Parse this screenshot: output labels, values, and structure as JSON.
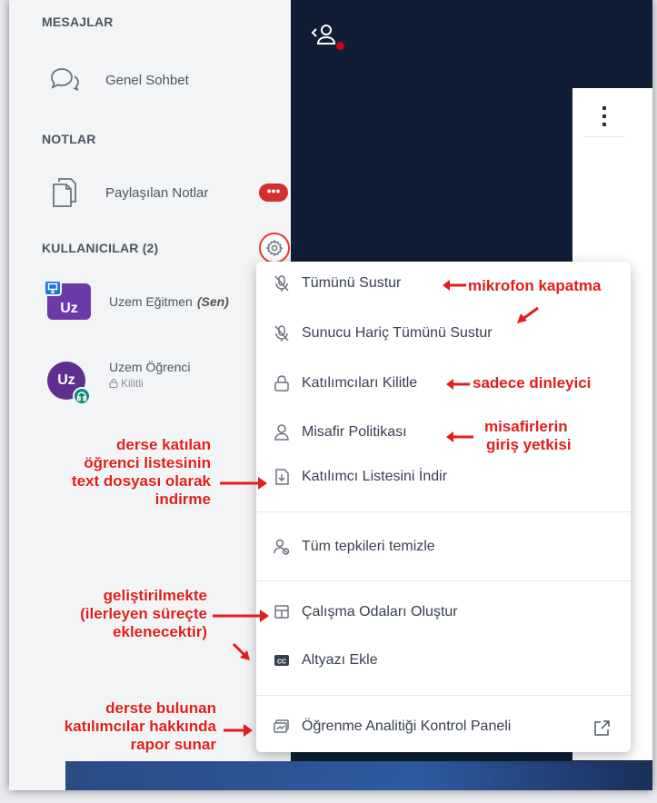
{
  "sidebar": {
    "sections": {
      "messages": "MESAJLAR",
      "notes": "NOTLAR",
      "users": "KULLANICILAR (2)"
    },
    "general_chat": "Genel Sohbet",
    "shared_notes": "Paylaşılan Notlar",
    "shared_notes_badge": "•••",
    "users": [
      {
        "initials": "Uz",
        "name": "Uzem Eğitmen",
        "tag": "(Sen)",
        "sub": ""
      },
      {
        "initials": "Uz",
        "name": "Uzem Öğrenci",
        "tag": "",
        "sub": "Kilitli"
      }
    ]
  },
  "menu": {
    "items": [
      {
        "label": "Tümünü Sustur",
        "icon": "mic-off-icon"
      },
      {
        "label": "Sunucu Hariç Tümünü Sustur",
        "icon": "mic-off-icon"
      },
      {
        "label": "Katılımcıları Kilitle",
        "icon": "lock-icon"
      },
      {
        "label": "Misafir Politikası",
        "icon": "user-icon"
      },
      {
        "label": "Katılımcı Listesini İndir",
        "icon": "download-file-icon"
      },
      {
        "label": "Tüm tepkileri temizle",
        "icon": "clear-reactions-icon"
      },
      {
        "label": "Çalışma Odaları Oluştur",
        "icon": "breakout-rooms-icon"
      },
      {
        "label": "Altyazı Ekle",
        "icon": "closed-caption-icon"
      },
      {
        "label": "Öğrenme Analitiği Kontrol Paneli",
        "icon": "analytics-icon"
      }
    ]
  },
  "annotations": {
    "mute_all": "mikrofon kapatma",
    "lock": "sadece dinleyici",
    "guest_1": "misafirlerin",
    "guest_2": "giriş yetkisi",
    "download_1": "derse katılan",
    "download_2": "öğrenci listesinin",
    "download_3": "text dosyası olarak",
    "download_4": "indirme",
    "dev_1": "geliştirilmekte",
    "dev_2": "(ilerleyen süreçte",
    "dev_3": "eklenecektir)",
    "report_1": "derste bulunan",
    "report_2": "katılımcılar hakkında",
    "report_3": "rapor sunar"
  },
  "colors": {
    "accent_red": "#e11d1d",
    "dark_panel": "#0f1e34",
    "avatar_purple": "#6a3ba8"
  }
}
